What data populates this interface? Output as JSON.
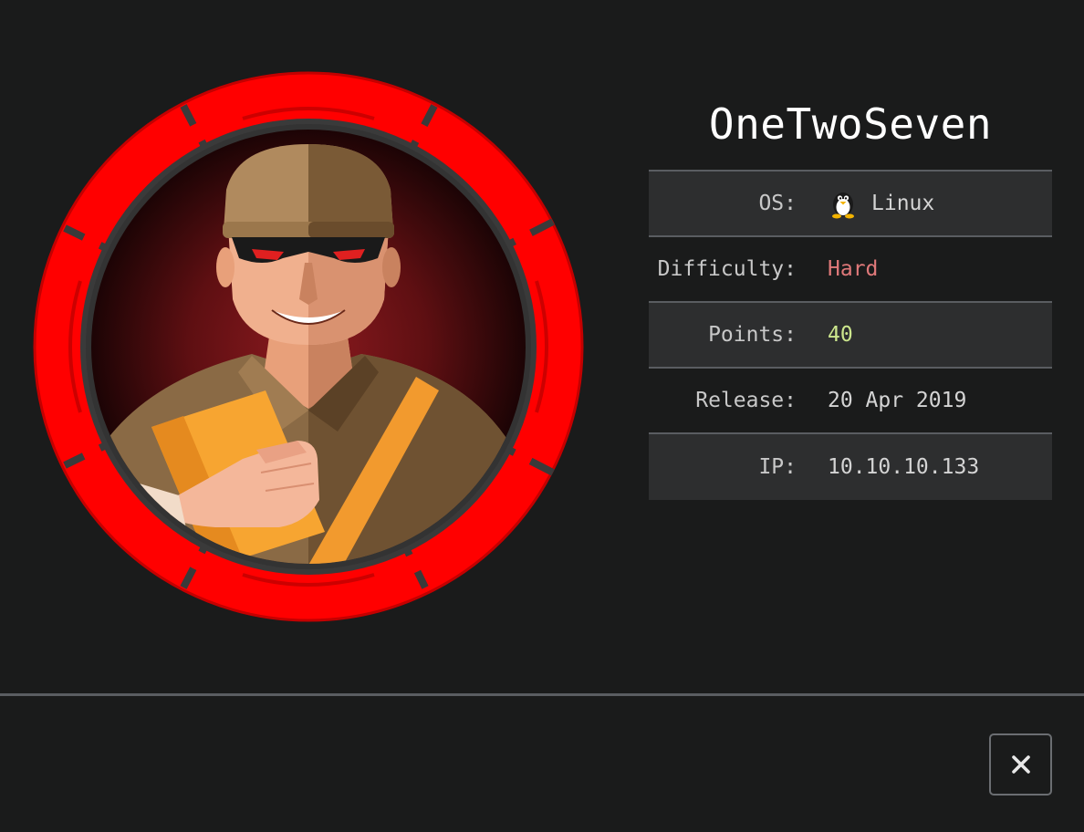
{
  "machine": {
    "name": "OneTwoSeven",
    "avatar": "onetwoseven-machine-avatar"
  },
  "info": [
    {
      "label": "OS:",
      "value": "Linux",
      "icon": "tux-icon"
    },
    {
      "label": "Difficulty:",
      "value": "Hard",
      "color": "#e0797a"
    },
    {
      "label": "Points:",
      "value": "40",
      "color": "#cce68d"
    },
    {
      "label": "Release:",
      "value": "20 Apr 2019"
    },
    {
      "label": "IP:",
      "value": "10.10.10.133"
    }
  ],
  "footer": {
    "close_icon": "close-icon"
  },
  "colors": {
    "background": "#1a1b1b",
    "row_shade": "#2d2e2f",
    "ring_red": "#ff0000",
    "hard": "#e0797a",
    "points": "#cce68d"
  }
}
